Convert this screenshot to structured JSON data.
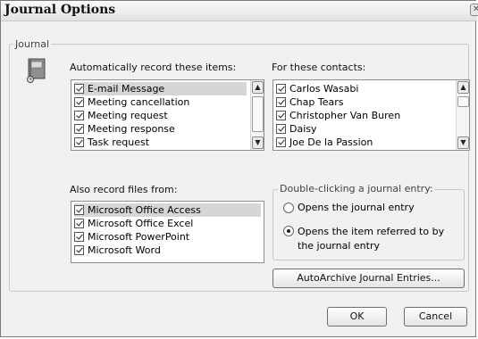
{
  "dialog": {
    "title": "Journal Options"
  },
  "journal_group": {
    "legend": "Journal"
  },
  "auto_record": {
    "label": "Automatically record these items:",
    "items": [
      {
        "label": "E-mail Message",
        "checked": true,
        "selected": true
      },
      {
        "label": "Meeting cancellation",
        "checked": true
      },
      {
        "label": "Meeting request",
        "checked": true
      },
      {
        "label": "Meeting response",
        "checked": true
      },
      {
        "label": "Task request",
        "checked": true
      }
    ]
  },
  "contacts": {
    "label": "For these contacts:",
    "items": [
      {
        "label": "Carlos Wasabi",
        "checked": true
      },
      {
        "label": "Chap Tears",
        "checked": true
      },
      {
        "label": "Christopher Van Buren",
        "checked": true
      },
      {
        "label": "Daisy",
        "checked": true
      },
      {
        "label": "Joe De la Passion",
        "checked": true
      }
    ]
  },
  "files": {
    "label": "Also record files from:",
    "items": [
      {
        "label": "Microsoft Office Access",
        "checked": true,
        "selected": true
      },
      {
        "label": "Microsoft Office Excel",
        "checked": true
      },
      {
        "label": "Microsoft PowerPoint",
        "checked": true
      },
      {
        "label": "Microsoft Word",
        "checked": true
      }
    ]
  },
  "double_click": {
    "legend": "Double-clicking a journal entry:",
    "option1": "Opens the journal entry",
    "option2_line1": "Opens the item referred to by",
    "option2_line2": "the journal entry",
    "selected_option": 2
  },
  "buttons": {
    "autoarchive": "AutoArchive Journal Entries...",
    "ok": "OK",
    "cancel": "Cancel"
  }
}
